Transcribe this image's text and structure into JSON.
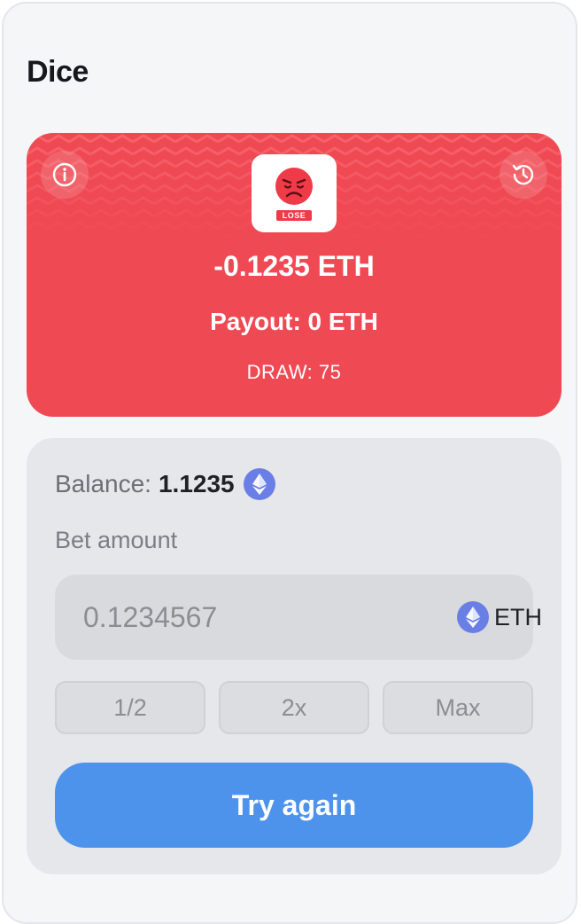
{
  "game": {
    "title": "Dice"
  },
  "result": {
    "amount": "-0.1235 ETH",
    "payout": "Payout: 0 ETH",
    "draw": "DRAW: 75",
    "badge": "LOSE",
    "icon": "angry-face-icon",
    "background_color": "#ef4a53"
  },
  "bet": {
    "balance_label": "Balance:",
    "balance_value": "1.1235",
    "amount_label": "Bet amount",
    "input_placeholder": "0.1234567",
    "currency": "ETH",
    "quick_buttons": [
      "1/2",
      "2x",
      "Max"
    ],
    "action_label": "Try again",
    "action_color": "#4d93ec"
  }
}
